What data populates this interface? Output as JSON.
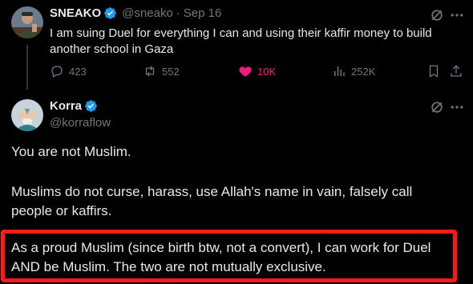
{
  "tweet": {
    "author_name": "SNEAKO",
    "handle": "@sneako",
    "separator": "·",
    "time": "Sep 16",
    "text_line1": "I am suing Duel for everything I can and using their kaffir money to build",
    "text_line2": "another school in Gaza",
    "stats": {
      "replies": "423",
      "retweets": "552",
      "likes": "10K",
      "views": "252K"
    }
  },
  "reply": {
    "author_name": "Korra",
    "handle": "@korraflow",
    "para1": "You are not Muslim.",
    "para2_line1": "Muslims do not curse, harass, use Allah's name in vain, falsely call",
    "para2_line2": "people or kaffirs.",
    "para3_line1": "As a proud Muslim (since birth btw, not a convert), I can work for Duel",
    "para3_line2": "AND be Muslim. The two are not mutually exclusive."
  },
  "colors": {
    "background": "#000000",
    "text": "#e7e9ea",
    "muted": "#71767b",
    "verified": "#1d9bf0",
    "like": "#f91880",
    "highlight": "#ff1a1a"
  }
}
